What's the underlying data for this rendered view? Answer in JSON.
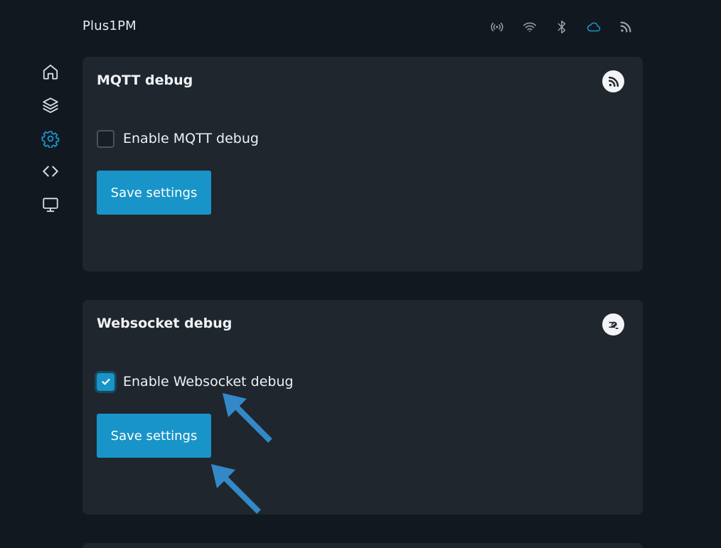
{
  "header": {
    "device_name": "Plus1PM",
    "status_icons": [
      "signal-broadcast-icon",
      "wifi-icon",
      "bluetooth-icon",
      "cloud-icon",
      "rss-feed-icon"
    ]
  },
  "sidebar": {
    "items": [
      {
        "icon": "home-icon"
      },
      {
        "icon": "layers-icon"
      },
      {
        "icon": "gear-icon",
        "active": true
      },
      {
        "icon": "code-icon"
      },
      {
        "icon": "monitor-icon"
      }
    ]
  },
  "mqtt_card": {
    "title": "MQTT debug",
    "icon": "rss-feed-icon",
    "checkbox_label": "Enable MQTT debug",
    "checked": false,
    "save_label": "Save settings"
  },
  "websocket_card": {
    "title": "Websocket debug",
    "icon": "websocket-icon",
    "checkbox_label": "Enable Websocket debug",
    "checked": true,
    "save_label": "Save settings"
  },
  "colors": {
    "background": "#111820",
    "card": "#20262e",
    "accent": "#1894c8",
    "annotation_arrow": "#3389c8"
  }
}
